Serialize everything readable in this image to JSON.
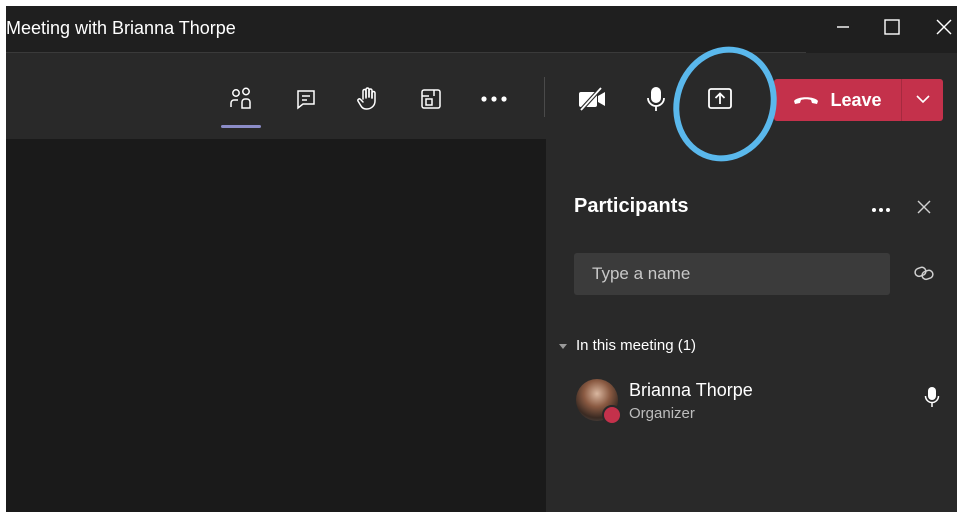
{
  "window": {
    "title": "Meeting with Brianna Thorpe",
    "controls": [
      "minimize-icon",
      "maximize-icon",
      "close-icon"
    ]
  },
  "toolbar": {
    "items": [
      {
        "name": "people",
        "icon": "people-icon",
        "active": true
      },
      {
        "name": "chat",
        "icon": "chat-icon"
      },
      {
        "name": "raise-hand",
        "icon": "raise-hand-icon"
      },
      {
        "name": "rooms",
        "icon": "rooms-icon"
      },
      {
        "name": "more",
        "icon": "more-icon"
      },
      {
        "name": "camera",
        "icon": "camera-off-icon"
      },
      {
        "name": "mic",
        "icon": "mic-icon"
      },
      {
        "name": "share",
        "icon": "share-tray-icon"
      }
    ],
    "leave_label": "Leave",
    "colors": {
      "leave": "#c4314b",
      "active_underline": "#8b8cc7",
      "highlight": "#5ab8ec"
    }
  },
  "participants": {
    "title": "Participants",
    "search_placeholder": "Type a name",
    "section_label": "In this meeting (1)",
    "people": [
      {
        "name": "Brianna Thorpe",
        "role": "Organizer"
      }
    ]
  }
}
